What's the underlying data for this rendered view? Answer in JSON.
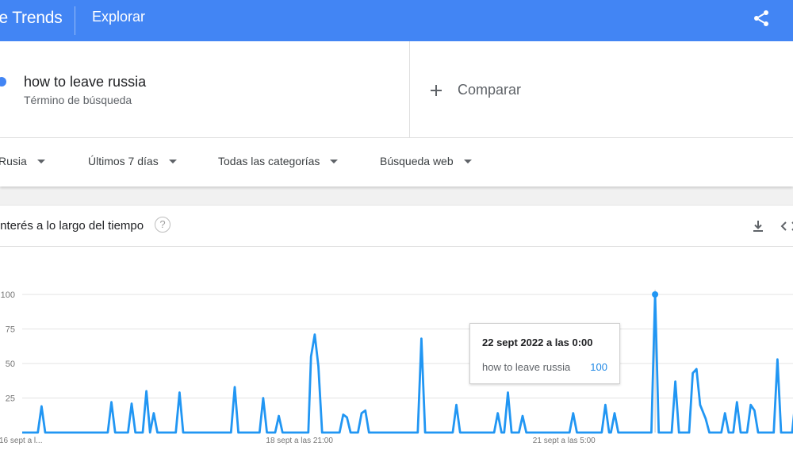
{
  "header": {
    "brand": "le Trends",
    "nav_title": "Explorar",
    "share_icon": "share-icon",
    "color": "#4285f4"
  },
  "search_term": {
    "name": "how to leave russia",
    "type_label": "Término de búsqueda",
    "color": "#4285f4"
  },
  "compare": {
    "label": "Comparar",
    "icon": "plus-icon"
  },
  "filters": [
    {
      "label": "Rusia"
    },
    {
      "label": "Últimos 7 días"
    },
    {
      "label": "Todas las categorías"
    },
    {
      "label": "Búsqueda web"
    }
  ],
  "chart_section": {
    "title": "Interés a lo largo del tiempo",
    "help_icon_glyph": "?",
    "download_icon": "download-icon",
    "embed_icon": "embed-code-icon"
  },
  "tooltip": {
    "date": "22 sept 2022 a las 0:00",
    "term": "how to leave russia",
    "value": "100"
  },
  "chart_data": {
    "type": "line",
    "title": "",
    "xlabel": "",
    "ylabel": "",
    "ylim": [
      0,
      100
    ],
    "y_ticks": [
      "0",
      "25",
      "50",
      "75",
      "100"
    ],
    "x_tick_labels": [
      "16 sept a l...",
      "18 sept a las 21:00",
      "21 sept a las 5:00"
    ],
    "grid": true,
    "line_color": "#2196f3",
    "highlighted_point_index": 140,
    "series": [
      {
        "name": "how to leave russia",
        "values": [
          0,
          0,
          0,
          0,
          0,
          0,
          0,
          0,
          0,
          0,
          0,
          0,
          0,
          0,
          0,
          0,
          0,
          0,
          0,
          0,
          0,
          0,
          0,
          0,
          0,
          0,
          0,
          0,
          0,
          0,
          0,
          0,
          0,
          0,
          0,
          0,
          0,
          0,
          0,
          0,
          0,
          0,
          0,
          0,
          0,
          0,
          0,
          0,
          0,
          0,
          0,
          0,
          0,
          0,
          0,
          0,
          0,
          0,
          0,
          0,
          0,
          0,
          0,
          0,
          0,
          0,
          0,
          0,
          0,
          0,
          0,
          0,
          0,
          0,
          0,
          0,
          0,
          0,
          0,
          0,
          0,
          0,
          0,
          0,
          0,
          0,
          0,
          0,
          0,
          0,
          0,
          0,
          0,
          0,
          0,
          0,
          0,
          0,
          0,
          0,
          0,
          0,
          0,
          0,
          0,
          0,
          0,
          0,
          0,
          0,
          0,
          0,
          0,
          0,
          0,
          0,
          0,
          0,
          0,
          0,
          0,
          0,
          0,
          0,
          0,
          0,
          0,
          0,
          0,
          0,
          0,
          0,
          0,
          0,
          0,
          0,
          0,
          0,
          0,
          0,
          100,
          0,
          0,
          0,
          0,
          0,
          0,
          0,
          0,
          0,
          0,
          0,
          0,
          0,
          0,
          0,
          0,
          0,
          0,
          0,
          0,
          0,
          0,
          0,
          0,
          0,
          0,
          0
        ]
      }
    ],
    "points": [
      [
        0,
        0
      ],
      [
        3.4,
        0
      ],
      [
        4.2,
        19
      ],
      [
        5.0,
        0
      ],
      [
        18.6,
        0
      ],
      [
        19.4,
        22
      ],
      [
        20.2,
        0
      ],
      [
        23.0,
        0
      ],
      [
        23.8,
        21
      ],
      [
        24.6,
        0
      ],
      [
        26.2,
        0
      ],
      [
        27.0,
        30
      ],
      [
        27.8,
        0
      ],
      [
        28.6,
        14
      ],
      [
        29.4,
        0
      ],
      [
        33.4,
        0
      ],
      [
        34.2,
        29
      ],
      [
        35.0,
        0
      ],
      [
        45.4,
        0
      ],
      [
        46.2,
        33
      ],
      [
        47.0,
        0
      ],
      [
        51.6,
        0
      ],
      [
        52.4,
        25
      ],
      [
        53.2,
        0
      ],
      [
        55.0,
        0
      ],
      [
        55.8,
        12
      ],
      [
        56.6,
        0
      ],
      [
        62.2,
        0
      ],
      [
        62.8,
        55
      ],
      [
        63.6,
        71
      ],
      [
        64.4,
        48
      ],
      [
        65.2,
        0
      ],
      [
        69.0,
        0
      ],
      [
        69.8,
        13
      ],
      [
        70.6,
        11
      ],
      [
        71.4,
        0
      ],
      [
        73.0,
        0
      ],
      [
        73.8,
        14
      ],
      [
        74.6,
        16
      ],
      [
        75.4,
        0
      ],
      [
        86.0,
        0
      ],
      [
        86.8,
        68
      ],
      [
        87.6,
        0
      ],
      [
        93.6,
        0
      ],
      [
        94.4,
        20
      ],
      [
        95.2,
        0
      ],
      [
        102.6,
        0
      ],
      [
        103.4,
        14
      ],
      [
        104.2,
        0
      ],
      [
        104.8,
        0
      ],
      [
        105.6,
        29
      ],
      [
        106.4,
        0
      ],
      [
        108.0,
        0
      ],
      [
        108.8,
        12
      ],
      [
        109.6,
        0
      ],
      [
        119.0,
        0
      ],
      [
        119.8,
        14
      ],
      [
        120.6,
        0
      ],
      [
        126.0,
        0
      ],
      [
        126.8,
        20
      ],
      [
        127.6,
        0
      ],
      [
        128.0,
        0
      ],
      [
        128.8,
        14
      ],
      [
        129.6,
        0
      ],
      [
        136.8,
        0
      ],
      [
        137.6,
        100
      ],
      [
        138.4,
        0
      ],
      [
        141.2,
        0
      ],
      [
        142.0,
        37
      ],
      [
        142.8,
        0
      ],
      [
        145.0,
        0
      ],
      [
        145.8,
        43
      ],
      [
        146.6,
        46
      ],
      [
        147.4,
        20
      ],
      [
        148.6,
        10
      ],
      [
        149.4,
        0
      ],
      [
        152.0,
        0
      ],
      [
        152.8,
        14
      ],
      [
        153.6,
        0
      ],
      [
        154.6,
        0
      ],
      [
        155.4,
        22
      ],
      [
        156.2,
        0
      ],
      [
        157.6,
        0
      ],
      [
        158.4,
        20
      ],
      [
        159.2,
        16
      ],
      [
        160.0,
        0
      ],
      [
        163.4,
        0
      ],
      [
        164.2,
        53
      ],
      [
        165.0,
        0
      ],
      [
        167.4,
        0
      ],
      [
        168.2,
        26
      ],
      [
        169.0,
        0
      ]
    ]
  }
}
